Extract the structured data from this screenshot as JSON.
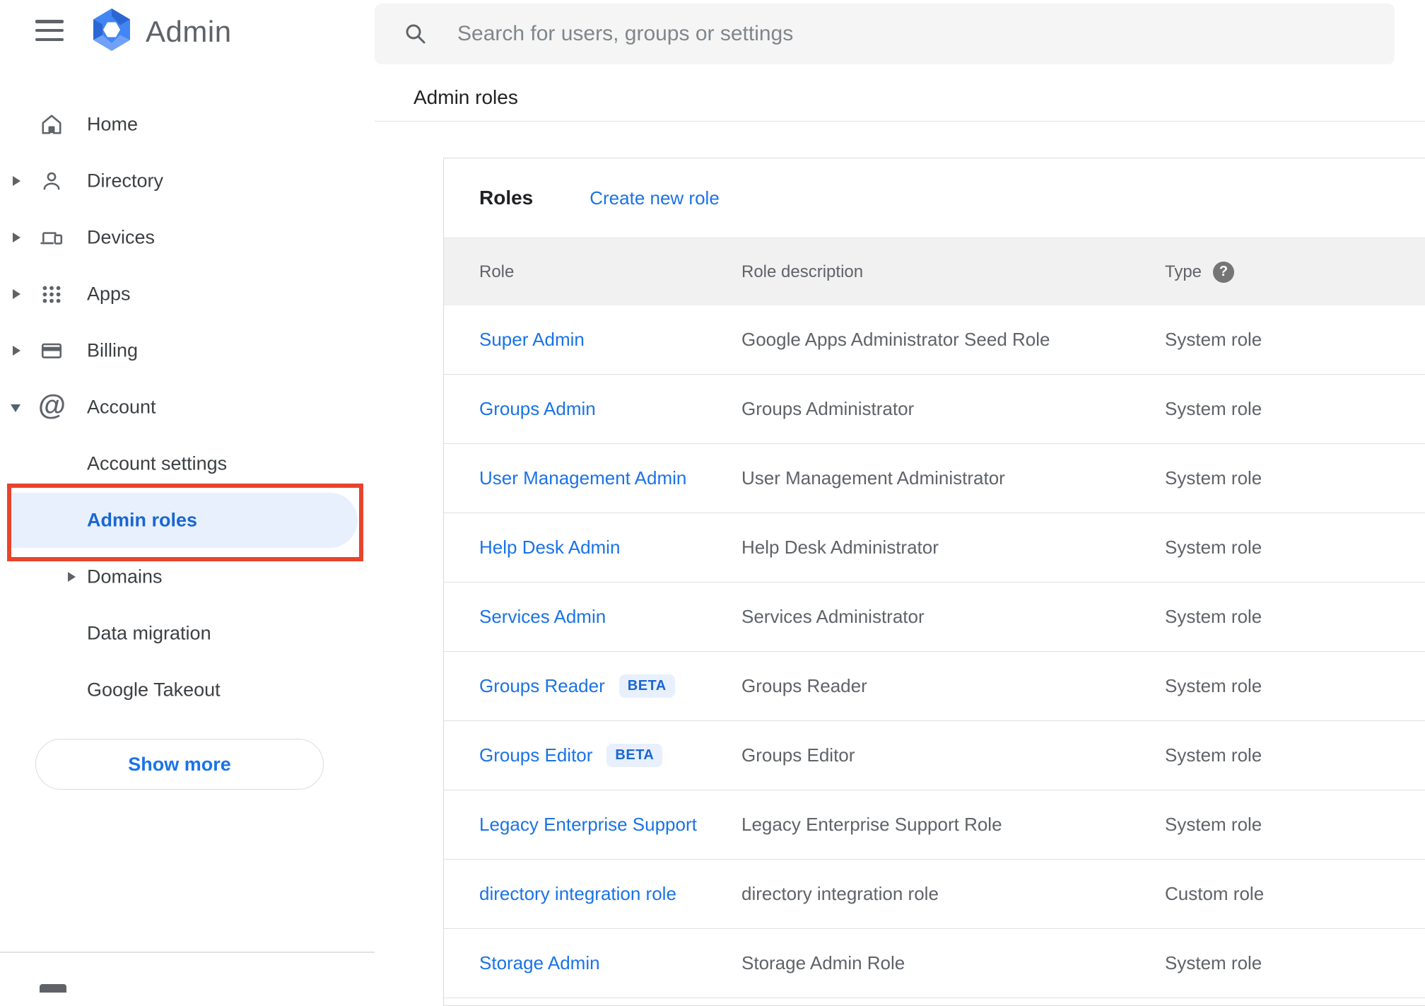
{
  "topbar": {
    "product_name": "Admin",
    "search_placeholder": "Search for users, groups or settings"
  },
  "breadcrumb": "Admin roles",
  "sidebar": {
    "items": [
      {
        "label": "Home"
      },
      {
        "label": "Directory"
      },
      {
        "label": "Devices"
      },
      {
        "label": "Apps"
      },
      {
        "label": "Billing"
      },
      {
        "label": "Account"
      }
    ],
    "sub_items": [
      {
        "label": "Account settings"
      },
      {
        "label": "Admin roles",
        "selected": true
      },
      {
        "label": "Domains"
      },
      {
        "label": "Data migration"
      },
      {
        "label": "Google Takeout"
      }
    ],
    "show_more_label": "Show more"
  },
  "roles_panel": {
    "title": "Roles",
    "create_link": "Create new role",
    "columns": {
      "role": "Role",
      "description": "Role description",
      "type": "Type"
    },
    "help_glyph": "?",
    "rows": [
      {
        "role": "Super Admin",
        "description": "Google Apps Administrator Seed Role",
        "type": "System role"
      },
      {
        "role": "Groups Admin",
        "description": "Groups Administrator",
        "type": "System role"
      },
      {
        "role": "User Management Admin",
        "description": "User Management Administrator",
        "type": "System role"
      },
      {
        "role": "Help Desk Admin",
        "description": "Help Desk Administrator",
        "type": "System role"
      },
      {
        "role": "Services Admin",
        "description": "Services Administrator",
        "type": "System role"
      },
      {
        "role": "Groups Reader",
        "badge": "BETA",
        "description": "Groups Reader",
        "type": "System role"
      },
      {
        "role": "Groups Editor",
        "badge": "BETA",
        "description": "Groups Editor",
        "type": "System role"
      },
      {
        "role": "Legacy Enterprise Support",
        "description": "Legacy Enterprise Support Role",
        "type": "System role"
      },
      {
        "role": "directory integration role",
        "description": "directory integration role",
        "type": "Custom role"
      },
      {
        "role": "Storage Admin",
        "description": "Storage Admin Role",
        "type": "System role"
      }
    ]
  },
  "colors": {
    "link_blue": "#1a73e8",
    "selected_blue": "#1967d2",
    "selected_bg": "#e8f0fe",
    "annotation_red": "#e8432c",
    "logo_blue": "#4285f4"
  }
}
